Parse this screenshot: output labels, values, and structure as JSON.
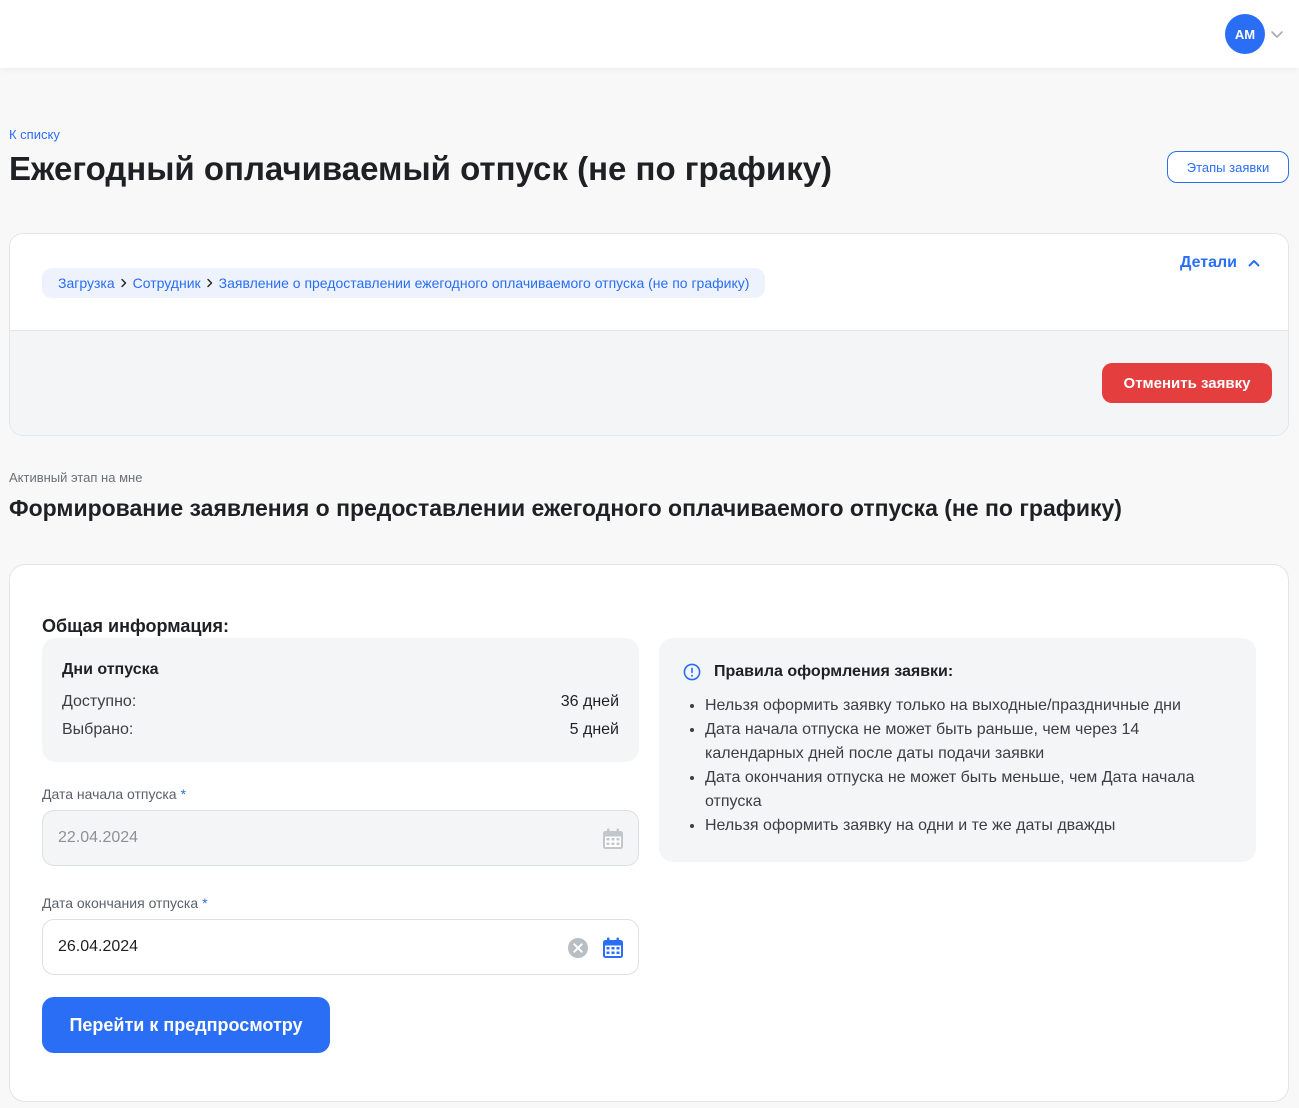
{
  "header": {
    "avatar_initials": "АМ"
  },
  "page": {
    "back_link": "К списку",
    "title": "Ежегодный оплачиваемый отпуск (не по графику)",
    "stages_button": "Этапы заявки"
  },
  "details": {
    "toggle_label": "Детали",
    "breadcrumb": [
      "Загрузка",
      "Сотрудник",
      "Заявление о предоставлении ежегодного оплачиваемого отпуска (не по графику)"
    ],
    "cancel_button": "Отменить заявку"
  },
  "stage": {
    "caption": "Активный этап на мне",
    "title": "Формирование заявления о предоставлении ежегодного оплачиваемого отпуска (не по графику)"
  },
  "form": {
    "section_title": "Общая информация:",
    "vacation_days": {
      "title": "Дни отпуска",
      "available_label": "Доступно:",
      "available_value": "36 дней",
      "selected_label": "Выбрано:",
      "selected_value": "5 дней"
    },
    "start_date": {
      "label": "Дата начала отпуска",
      "required_mark": "*",
      "value": "22.04.2024"
    },
    "end_date": {
      "label": "Дата окончания отпуска",
      "required_mark": "*",
      "value": "26.04.2024"
    },
    "preview_button": "Перейти к предпросмотру"
  },
  "rules": {
    "title": "Правила оформления заявки:",
    "items": [
      "Нельзя оформить заявку только на выходные/праздничные дни",
      "Дата начала отпуска не может быть раньше, чем через 14 календарных дней после даты подачи заявки",
      "Дата окончания отпуска не может быть меньше, чем Дата начала отпуска",
      "Нельзя оформить заявку на одни и те же даты дважды"
    ]
  },
  "colors": {
    "accent": "#2a6ef5",
    "danger": "#e53e3e",
    "panel": "#f4f5f7"
  }
}
